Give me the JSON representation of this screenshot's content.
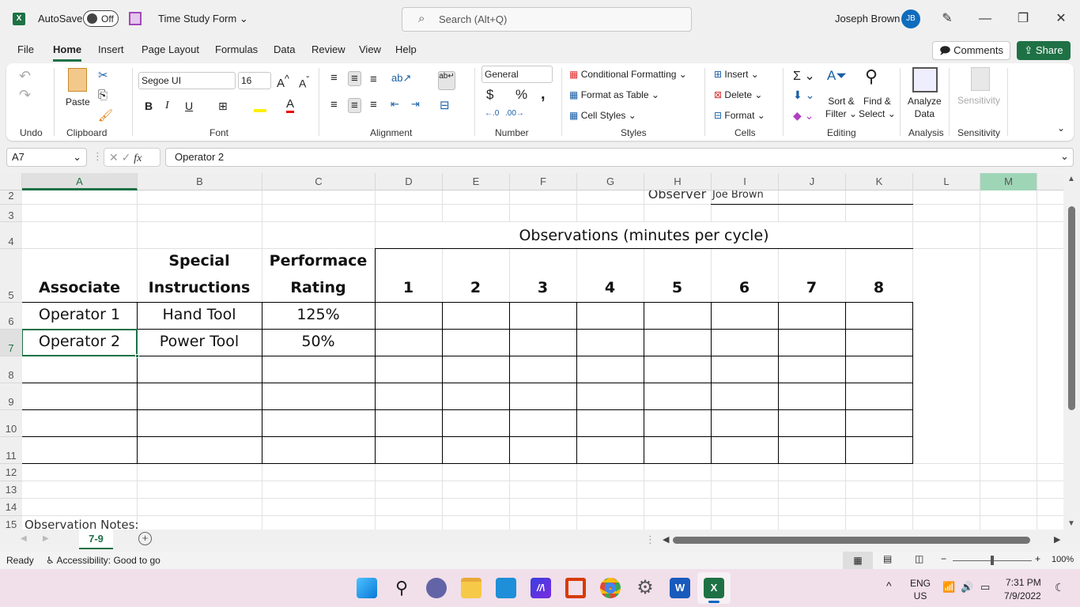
{
  "titlebar": {
    "app_icon": "excel-icon",
    "autosave_label": "AutoSave",
    "autosave_state": "Off",
    "save_icon": "save-icon",
    "document_title": "Time Study Form",
    "search_placeholder": "Search (Alt+Q)",
    "user_name": "Joseph Brown",
    "user_initials": "JB",
    "window_controls": [
      "minimize",
      "restore",
      "close"
    ]
  },
  "menu": {
    "tabs": [
      "File",
      "Home",
      "Insert",
      "Page Layout",
      "Formulas",
      "Data",
      "Review",
      "View",
      "Help"
    ],
    "active_tab": "Home",
    "comments_label": "Comments",
    "share_label": "Share"
  },
  "ribbon": {
    "groups": {
      "undo": "Undo",
      "clipboard": "Clipboard",
      "font": "Font",
      "alignment": "Alignment",
      "number": "Number",
      "styles": "Styles",
      "cells": "Cells",
      "editing": "Editing",
      "analysis": "Analysis",
      "sensitivity": "Sensitivity"
    },
    "paste_label": "Paste",
    "font_name": "Segoe UI",
    "font_size": "16",
    "number_format": "General",
    "conditional_formatting": "Conditional Formatting",
    "format_as_table": "Format as Table",
    "cell_styles": "Cell Styles",
    "insert": "Insert",
    "delete": "Delete",
    "format": "Format",
    "sort_filter": [
      "Sort &",
      "Filter"
    ],
    "find_select": [
      "Find &",
      "Select"
    ],
    "analyze_data": [
      "Analyze",
      "Data"
    ],
    "sensitivity_btn": "Sensitivity",
    "bold": "B",
    "italic": "I",
    "underline": "U"
  },
  "formula_bar": {
    "name_box": "A7",
    "fx": "fx",
    "content": "Operator 2"
  },
  "columns": [
    "A",
    "B",
    "C",
    "D",
    "E",
    "F",
    "G",
    "H",
    "I",
    "J",
    "K",
    "L",
    "M"
  ],
  "selected_column": "A",
  "rows": [
    "2",
    "3",
    "4",
    "5",
    "6",
    "7",
    "8",
    "9",
    "10",
    "11",
    "12",
    "13",
    "14",
    "15"
  ],
  "sheet": {
    "observer_label": "Observer",
    "observer_name": "Joe Brown",
    "observations_header": "Observations (minutes per cycle)",
    "headers": {
      "associate": "Associate",
      "special": "Special",
      "instructions": "Instructions",
      "performace": "Performace",
      "rating": "Rating",
      "observations": [
        "1",
        "2",
        "3",
        "4",
        "5",
        "6",
        "7",
        "8"
      ]
    },
    "data_rows": [
      {
        "associate": "Operator 1",
        "instructions": "Hand Tool",
        "rating": "125%"
      },
      {
        "associate": "Operator 2",
        "instructions": "Power Tool",
        "rating": "50%"
      }
    ],
    "notes_label": "Observation Notes:"
  },
  "sheet_tabs": {
    "tabs": [
      "7-9"
    ],
    "active": "7-9"
  },
  "status": {
    "ready": "Ready",
    "accessibility": "Accessibility: Good to go",
    "zoom": "100%"
  },
  "taskbar": {
    "apps": [
      "start",
      "search",
      "teams-chat",
      "file-explorer",
      "mail",
      "app",
      "office",
      "chrome",
      "settings",
      "word",
      "excel"
    ],
    "lang_top": "ENG",
    "lang_bottom": "US",
    "time": "7:31 PM",
    "date": "7/9/2022"
  }
}
